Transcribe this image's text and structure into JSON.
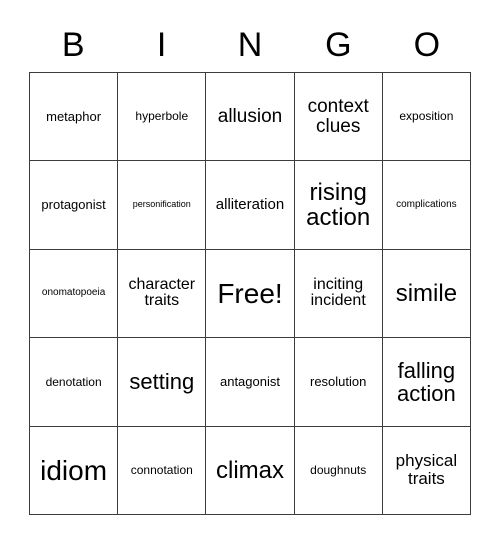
{
  "card": {
    "title": "BINGO",
    "header_letters": [
      "B",
      "I",
      "N",
      "G",
      "O"
    ],
    "free_space_label": "Free!",
    "background_color": "#ffffff",
    "text_color": "#000000",
    "grid_line_color": "#3c3c3c",
    "rows": 5,
    "columns": 5
  },
  "grid": {
    "row0": {
      "c0": "metaphor",
      "c1": "hyperbole",
      "c2": "allusion",
      "c3": "context clues",
      "c4": "exposition"
    },
    "row1": {
      "c0": "protagonist",
      "c1": "personification",
      "c2": "alliteration",
      "c3": "rising action",
      "c4": "complications"
    },
    "row2": {
      "c0": "onomatopoeia",
      "c1": "character traits",
      "c2": "Free!",
      "c3": "inciting incident",
      "c4": "simile"
    },
    "row3": {
      "c0": "denotation",
      "c1": "setting",
      "c2": "antagonist",
      "c3": "resolution",
      "c4": "falling action"
    },
    "row4": {
      "c0": "idiom",
      "c1": "connotation",
      "c2": "climax",
      "c3": "doughnuts",
      "c4": "physical traits"
    }
  }
}
